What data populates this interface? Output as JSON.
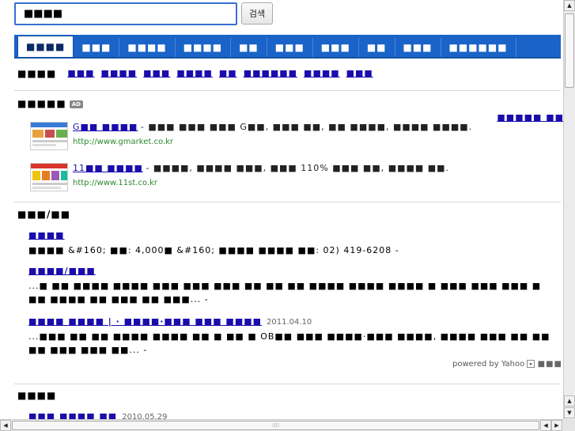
{
  "search": {
    "value": "■■■■",
    "button_label": "검색"
  },
  "tabs": [
    "■■■■",
    "■■■",
    "■■■■",
    "■■■■",
    "■■",
    "■■■",
    "■■■",
    "■■",
    "■■■",
    "■■■■■■"
  ],
  "related": {
    "label": "■■■■",
    "items": [
      "■■■",
      "■■■■",
      "■■■",
      "■■■■",
      "■■",
      "■■■■■■",
      "■■■■",
      "■■■"
    ]
  },
  "sponsored": {
    "title": "■■■■■",
    "badge": "AD",
    "more": "■■■■■ ■■",
    "items": [
      {
        "title": "G■■ ■■■■",
        "desc": "- ■■■ ■■■ ■■■ G■■, ■■■ ■■, ■■ ■■■■, ■■■■ ■■■■.",
        "url": "http://www.gmarket.co.kr"
      },
      {
        "title": "11■■ ■■■■",
        "desc": "- ■■■■, ■■■■ ■■■, ■■■ 110% ■■■ ■■, ■■■■ ■■.",
        "url": "http://www.11st.co.kr"
      }
    ]
  },
  "local": {
    "title": "■■■/■■",
    "items": [
      {
        "title": "■■■■",
        "date": "",
        "desc": "■■■■ &#160; ■■: 4,000■ &#160; ■■■■ ■■■■ ■■: 02) 419-6208 -"
      },
      {
        "title": "■■■■/■■■",
        "date": "",
        "desc": "...■ ■■ ■■■■ ■■■■ ■■■ ■■■ ■■■ ■■ ■■ ■■ ■■■■ ■■■■ ■■■■ ■ ■■■ ■■■ ■■■ ■ ■■ ■■■■ ■■ ■■■ ■■ ■■■... -"
      },
      {
        "title": "■■■■ ■■■■ | · ■■■■·■■■ ■■■ ■■■■",
        "date": "2011.04.10",
        "desc": "...■■■ ■■ ■■ ■■■■ ■■■■ ■■ ■ ■■ ■ OB■■ ■■■ ■■■■·■■■ ■■■■, ■■■■ ■■■ ■■ ■■ ■■ ■■■ ■■■ ■■... -"
      }
    ],
    "powered": "powered by Yahoo"
  },
  "next_section": {
    "title": "■■■■",
    "first_item": "■■■ ■■■■ ■■",
    "first_date": "2010.05.29"
  }
}
